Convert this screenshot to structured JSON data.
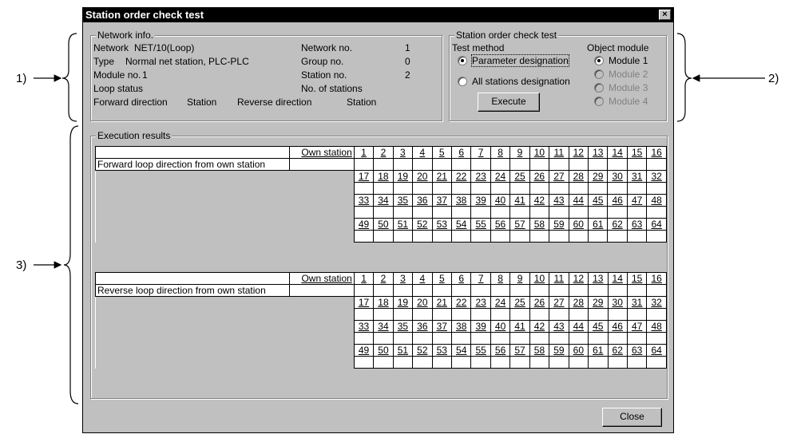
{
  "callouts": {
    "c1": "1)",
    "c2": "2)",
    "c3": "3)"
  },
  "dialog": {
    "title": "Station order check test",
    "close_glyph": "×",
    "close_button": "Close"
  },
  "network_info": {
    "title": "Network info.",
    "network_label": "Network",
    "network_value": "NET/10(Loop)",
    "type_label": "Type",
    "type_value": "Normal net station, PLC-PLC",
    "module_no_label": "Module no.",
    "module_no_value": "1",
    "loop_status_label": "Loop status",
    "forward_direction_label": "Forward direction",
    "forward_station_label": "Station",
    "reverse_direction_label": "Reverse direction",
    "reverse_station_label": "Station",
    "network_no_label": "Network no.",
    "network_no_value": "1",
    "group_no_label": "Group no.",
    "group_no_value": "0",
    "station_no_label": "Station no.",
    "station_no_value": "2",
    "num_stations_label": "No. of stations"
  },
  "check_test": {
    "title": "Station order check test",
    "test_method_label": "Test method",
    "param_designation": "Parameter designation",
    "all_stations": "All stations designation",
    "execute": "Execute",
    "object_module_label": "Object module",
    "modules": [
      "Module 1",
      "Module 2",
      "Module 3",
      "Module 4"
    ]
  },
  "results": {
    "title": "Execution results",
    "own_station": "Own station",
    "forward_label": "Forward loop direction from own station",
    "reverse_label": "Reverse loop direction from own station",
    "rows": [
      [
        "1",
        "2",
        "3",
        "4",
        "5",
        "6",
        "7",
        "8",
        "9",
        "10",
        "11",
        "12",
        "13",
        "14",
        "15",
        "16"
      ],
      [
        "17",
        "18",
        "19",
        "20",
        "21",
        "22",
        "23",
        "24",
        "25",
        "26",
        "27",
        "28",
        "29",
        "30",
        "31",
        "32"
      ],
      [
        "33",
        "34",
        "35",
        "36",
        "37",
        "38",
        "39",
        "40",
        "41",
        "42",
        "43",
        "44",
        "45",
        "46",
        "47",
        "48"
      ],
      [
        "49",
        "50",
        "51",
        "52",
        "53",
        "54",
        "55",
        "56",
        "57",
        "58",
        "59",
        "60",
        "61",
        "62",
        "63",
        "64"
      ]
    ]
  }
}
